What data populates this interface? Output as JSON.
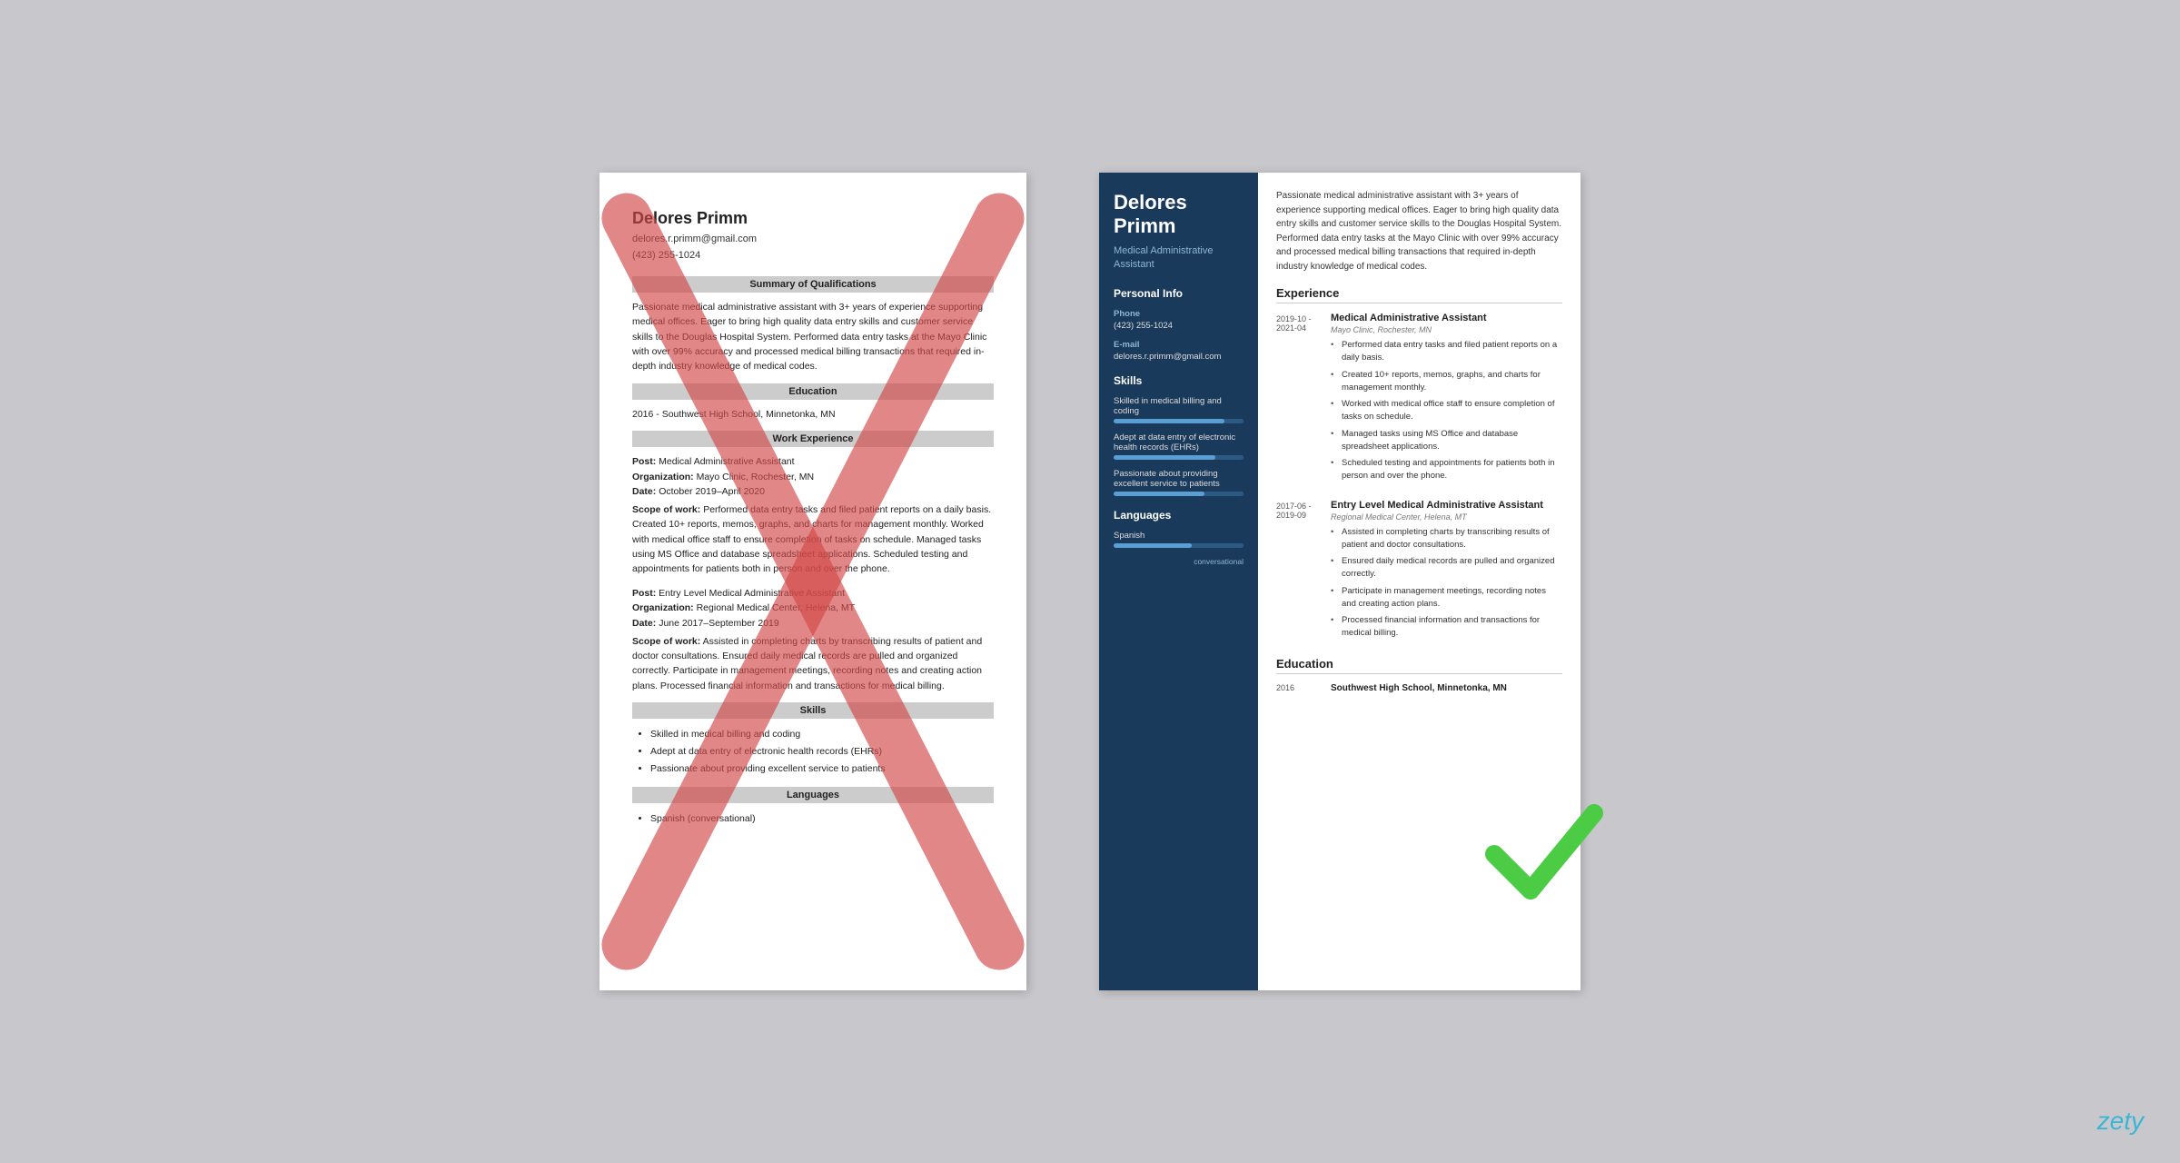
{
  "left_resume": {
    "name": "Delores Primm",
    "email": "delores.r.primm@gmail.com",
    "phone": "(423) 255-1024",
    "summary_header": "Summary of Qualifications",
    "summary_text": "Passionate medical administrative assistant with 3+ years of experience supporting medical offices. Eager to bring high quality data entry skills and customer service skills to the Douglas Hospital System. Performed data entry tasks at the Mayo Clinic with over 99% accuracy and processed medical billing transactions that required in-depth industry knowledge of medical codes.",
    "education_header": "Education",
    "education_text": "2016 - Southwest High School, Minnetonka, MN",
    "work_header": "Work Experience",
    "job1": {
      "post": "Medical Administrative Assistant",
      "org": "Mayo Clinic, Rochester, MN",
      "date": "October 2019–April 2020",
      "scope": "Performed data entry tasks and filed patient reports on a daily basis. Created 10+ reports, memos, graphs, and charts for management monthly. Worked with medical office staff to ensure completion of tasks on schedule. Managed tasks using MS Office and database spreadsheet applications. Scheduled testing and appointments for patients both in person and over the phone."
    },
    "job2": {
      "post": "Entry Level Medical Administrative Assistant",
      "org": "Regional Medical Center, Helena, MT",
      "date": "June 2017–September 2019",
      "scope": "Assisted in completing charts by transcribing results of patient and doctor consultations. Ensured daily medical records are pulled and organized correctly. Participate in management meetings, recording notes and creating action plans. Processed financial information and transactions for medical billing."
    },
    "skills_header": "Skills",
    "skills": [
      "Skilled in medical billing and coding",
      "Adept at data entry of electronic health records (EHRs)",
      "Passionate about providing excellent service to patients"
    ],
    "languages_header": "Languages",
    "languages": [
      "Spanish (conversational)"
    ]
  },
  "right_resume": {
    "name_line1": "Delores",
    "name_line2": "Primm",
    "title": "Medical Administrative Assistant",
    "sidebar": {
      "personal_info_label": "Personal Info",
      "phone_label": "Phone",
      "phone_value": "(423) 255-1024",
      "email_label": "E-mail",
      "email_value": "delores.r.primm@gmail.com",
      "skills_label": "Skills",
      "skills": [
        {
          "name": "Skilled in medical billing and coding",
          "pct": 85
        },
        {
          "name": "Adept at data entry of electronic health records (EHRs)",
          "pct": 78
        },
        {
          "name": "Passionate about providing excellent service to patients",
          "pct": 70
        }
      ],
      "languages_label": "Languages",
      "languages": [
        {
          "name": "Spanish",
          "level": "conversational",
          "pct": 60
        }
      ]
    },
    "summary": "Passionate medical administrative assistant with 3+ years of experience supporting medical offices. Eager to bring high quality data entry skills and customer service skills to the Douglas Hospital System. Performed data entry tasks at the Mayo Clinic with over 99% accuracy and processed medical billing transactions that required in-depth industry knowledge of medical codes.",
    "experience_label": "Experience",
    "jobs": [
      {
        "date_start": "2019-10 -",
        "date_end": "2021-04",
        "title": "Medical Administrative Assistant",
        "org": "Mayo Clinic, Rochester, MN",
        "bullets": [
          "Performed data entry tasks and filed patient reports on a daily basis.",
          "Created 10+ reports, memos, graphs, and charts for management monthly.",
          "Worked with medical office staff to ensure completion of tasks on schedule.",
          "Managed tasks using MS Office and database spreadsheet applications.",
          "Scheduled testing and appointments for patients both in person and over the phone."
        ]
      },
      {
        "date_start": "2017-06 -",
        "date_end": "2019-09",
        "title": "Entry Level Medical Administrative Assistant",
        "org": "Regional Medical Center, Helena, MT",
        "bullets": [
          "Assisted in completing charts by transcribing results of patient and doctor consultations.",
          "Ensured daily medical records are pulled and organized correctly.",
          "Participate in management meetings, recording notes and creating action plans.",
          "Processed financial information and transactions for medical billing."
        ]
      }
    ],
    "education_label": "Education",
    "education": [
      {
        "year": "2016",
        "school": "Southwest High School, Minnetonka, MN"
      }
    ]
  },
  "branding": {
    "logo": "zety"
  }
}
